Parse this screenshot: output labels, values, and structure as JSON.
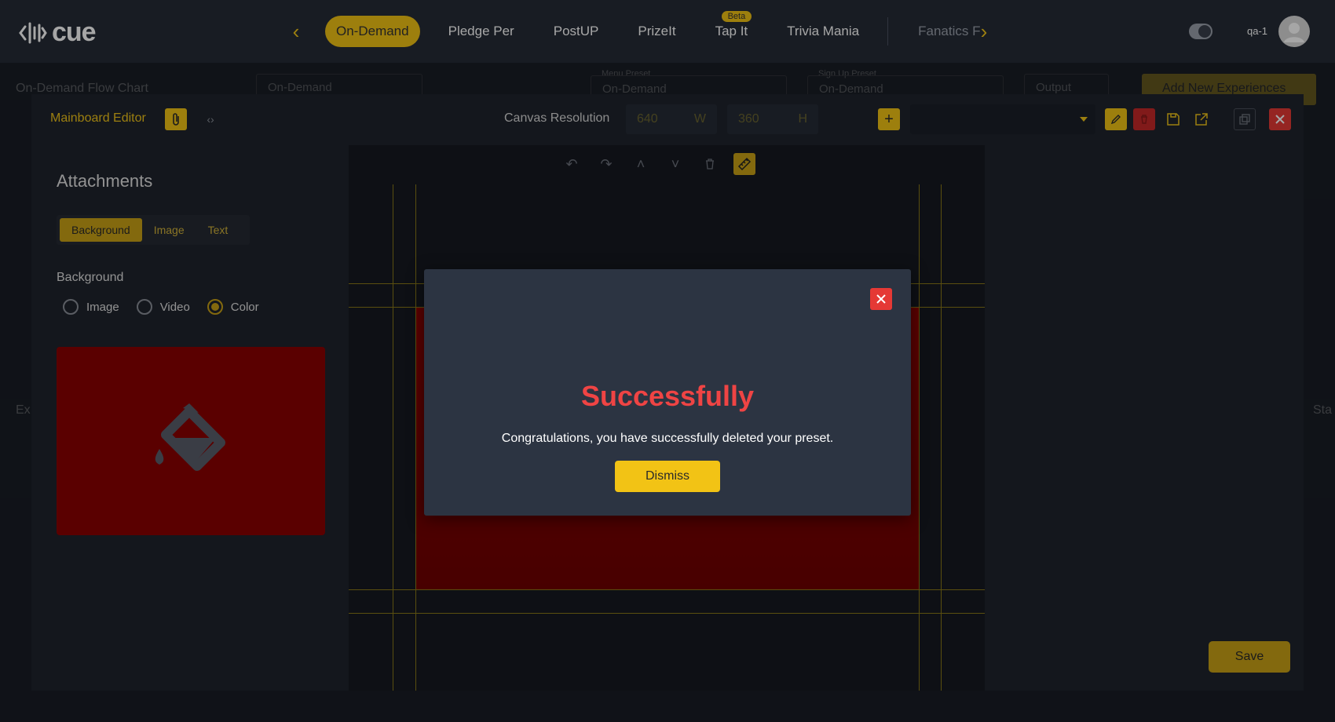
{
  "app": {
    "logo_text": "cue"
  },
  "nav": {
    "tabs": [
      {
        "label": "On-Demand",
        "active": true
      },
      {
        "label": "Pledge Per"
      },
      {
        "label": "PostUP"
      },
      {
        "label": "PrizeIt"
      },
      {
        "label": "Tap It",
        "badge": "Beta"
      },
      {
        "label": "Trivia Mania"
      },
      {
        "label": "Fanatics F"
      }
    ]
  },
  "user": {
    "name": "qa-1"
  },
  "background_page": {
    "title": "On-Demand Flow Chart",
    "experience_select": "On-Demand",
    "menu_preset_label": "Menu Preset",
    "menu_preset_value": "On-Demand",
    "signup_preset_label": "Sign Up Preset",
    "signup_preset_value": "On-Demand",
    "output_label": "Output",
    "add_new_label": "Add New Experiences",
    "left_fragment": "Ex",
    "right_fragment": "Sta"
  },
  "editor": {
    "title": "Mainboard Editor",
    "canvas_resolution_label": "Canvas Resolution",
    "width_value": "640",
    "width_unit": "W",
    "height_value": "360",
    "height_unit": "H",
    "save_label": "Save"
  },
  "attachments": {
    "title": "Attachments",
    "tabs": [
      "Background",
      "Image",
      "Text"
    ],
    "active_tab": "Background",
    "background_label": "Background",
    "options": [
      "Image",
      "Video",
      "Color"
    ],
    "selected_option": "Color",
    "color": "#8b0000"
  },
  "dialog": {
    "title": "Successfully",
    "message": "Congratulations, you have successfully deleted your preset.",
    "dismiss_label": "Dismiss"
  },
  "colors": {
    "accent": "#f2c315",
    "danger": "#e53935",
    "success_title": "#ef4444",
    "canvas_bg": "#8b0000"
  }
}
